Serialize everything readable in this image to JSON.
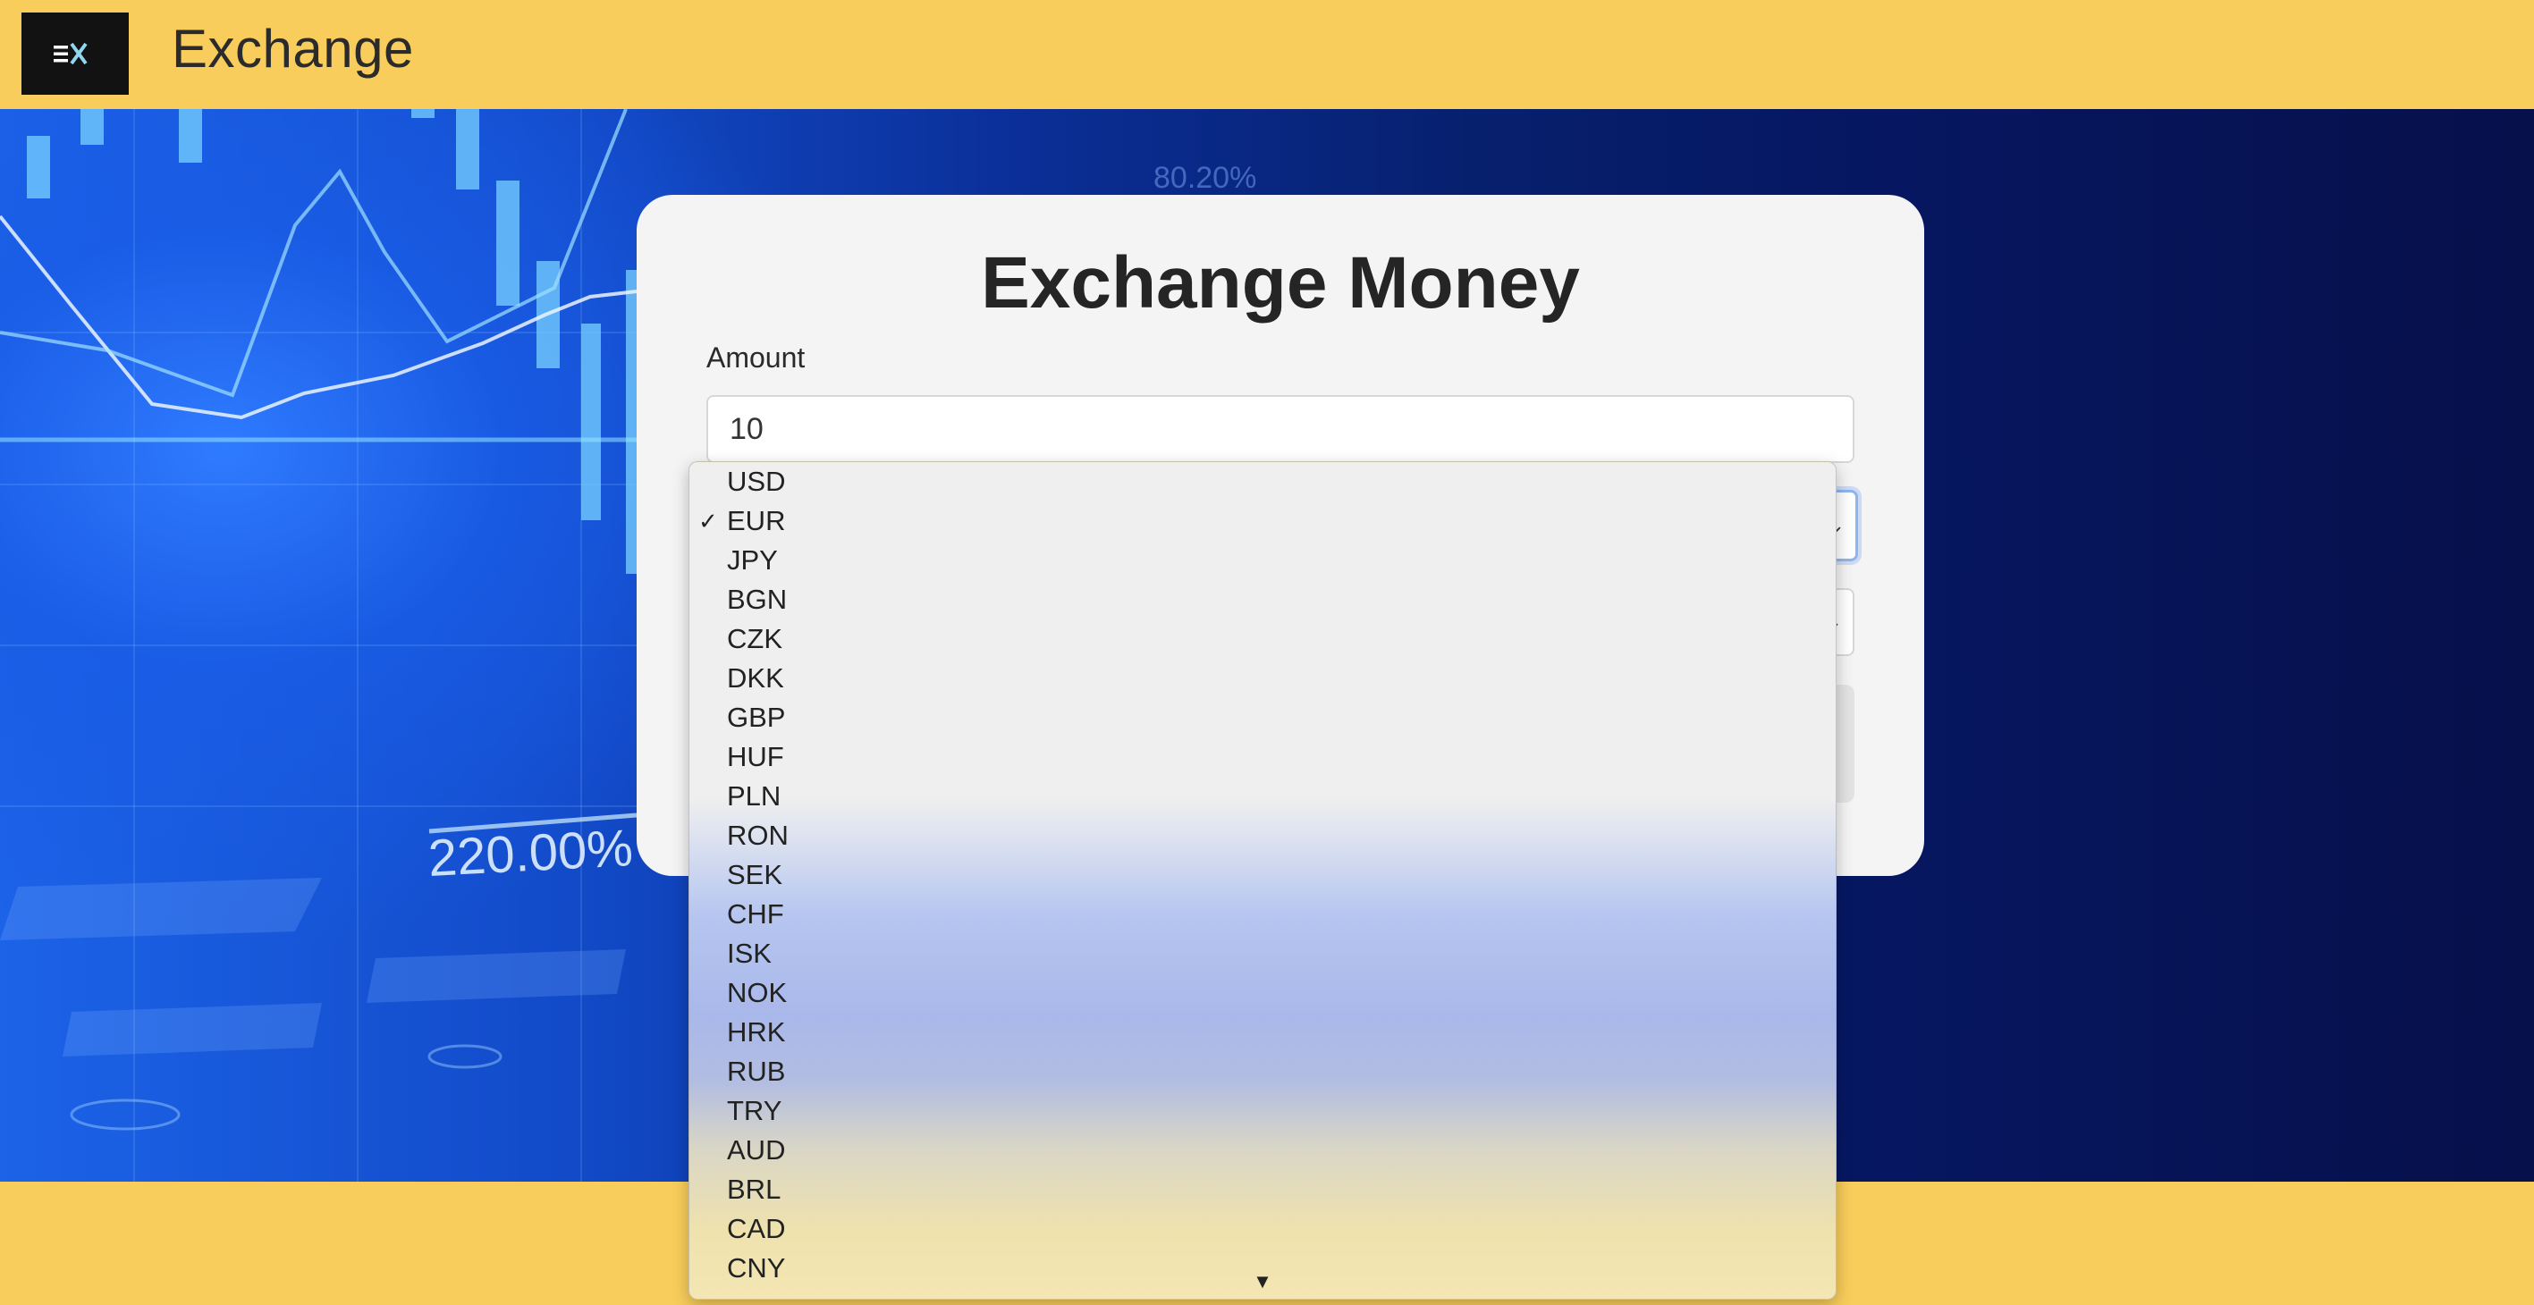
{
  "app": {
    "brand_name": "Exchange",
    "logo_text": "EX"
  },
  "hero": {
    "chart_label": "220.00%",
    "chart_label_top": "80.20%"
  },
  "card": {
    "title": "Exchange Money",
    "amount_label": "Amount",
    "amount_value": "10"
  },
  "dropdown": {
    "selected": "EUR",
    "options": [
      "USD",
      "EUR",
      "JPY",
      "BGN",
      "CZK",
      "DKK",
      "GBP",
      "HUF",
      "PLN",
      "RON",
      "SEK",
      "CHF",
      "ISK",
      "NOK",
      "HRK",
      "RUB",
      "TRY",
      "AUD",
      "BRL",
      "CAD",
      "CNY"
    ],
    "check_glyph": "✓",
    "scroll_down_glyph": "▼"
  },
  "colors": {
    "accent_yellow": "#f8cd5b",
    "hero_blue": "#1c63e8",
    "hero_navy": "#06104a",
    "card_bg": "#f4f4f4"
  }
}
